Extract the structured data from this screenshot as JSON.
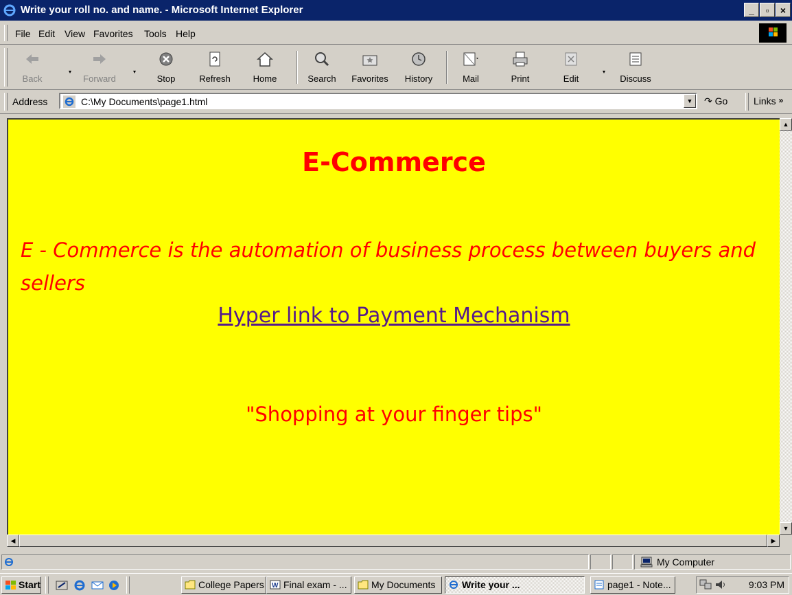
{
  "window": {
    "title": "Write your roll no. and name. - Microsoft Internet Explorer",
    "minimize_glyph": "_",
    "maximize_glyph": "▫",
    "close_glyph": "×"
  },
  "menu": {
    "items": [
      "File",
      "Edit",
      "View",
      "Favorites",
      "Tools",
      "Help"
    ]
  },
  "toolbar": {
    "buttons": [
      {
        "label": "Back",
        "icon": "back-arrow-icon",
        "enabled": false
      },
      {
        "label": "Forward",
        "icon": "forward-arrow-icon",
        "enabled": false
      },
      {
        "label": "Stop",
        "icon": "stop-icon",
        "enabled": true
      },
      {
        "label": "Refresh",
        "icon": "refresh-icon",
        "enabled": true
      },
      {
        "label": "Home",
        "icon": "home-icon",
        "enabled": true
      },
      {
        "label": "Search",
        "icon": "search-icon",
        "enabled": true
      },
      {
        "label": "Favorites",
        "icon": "favorites-icon",
        "enabled": true
      },
      {
        "label": "History",
        "icon": "history-icon",
        "enabled": true
      },
      {
        "label": "Mail",
        "icon": "mail-icon",
        "enabled": true
      },
      {
        "label": "Print",
        "icon": "print-icon",
        "enabled": true
      },
      {
        "label": "Edit",
        "icon": "edit-icon",
        "enabled": true
      },
      {
        "label": "Discuss",
        "icon": "discuss-icon",
        "enabled": true
      }
    ]
  },
  "address": {
    "label": "Address",
    "value": "C:\\My Documents\\page1.html",
    "go_label": "Go",
    "links_label": "Links"
  },
  "page": {
    "heading": "E-Commerce",
    "paragraph": "E - Commerce is the automation of business process between buyers and sellers",
    "link_text": "Hyper link to Payment Mechanism",
    "slogan": "\"Shopping at your finger tips\"",
    "background_color": "#ffff00",
    "text_color": "#ff0000",
    "link_color": "#551a8b"
  },
  "statusbar": {
    "zone": "My Computer"
  },
  "taskbar": {
    "start_label": "Start",
    "tasks": [
      {
        "label": "College Papers",
        "active": false
      },
      {
        "label": "Final exam - ...",
        "active": false
      },
      {
        "label": "My Documents",
        "active": false
      },
      {
        "label": "Write your ...",
        "active": true
      },
      {
        "label": "page1 - Note...",
        "active": false
      }
    ],
    "clock": "9:03 PM"
  },
  "colors": {
    "titlebar": "#0a246a",
    "chrome": "#d4d0c8"
  }
}
